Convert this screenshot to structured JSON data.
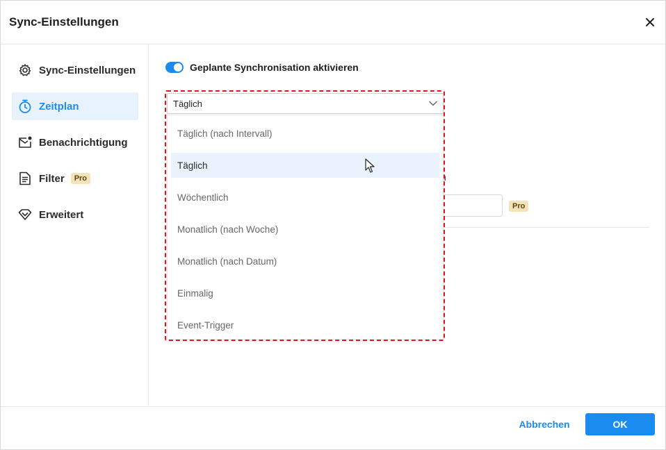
{
  "dialog": {
    "title": "Sync-Einstellungen"
  },
  "sidebar": {
    "items": [
      {
        "label": "Sync-Einstellungen",
        "icon": "gear-icon",
        "active": false
      },
      {
        "label": "Zeitplan",
        "icon": "stopwatch-icon",
        "active": true
      },
      {
        "label": "Benachrichtigung",
        "icon": "mail-notification-icon",
        "active": false
      },
      {
        "label": "Filter",
        "icon": "document-filter-icon",
        "active": false,
        "badge": "Pro"
      },
      {
        "label": "Erweitert",
        "icon": "diamond-icon",
        "active": false
      }
    ]
  },
  "schedule": {
    "toggle_label": "Geplante Synchronisation aktivieren",
    "toggle_on": true,
    "select_value": "Täglich",
    "options": [
      "Täglich (nach Intervall)",
      "Täglich",
      "Wöchentlich",
      "Monatlich (nach Woche)",
      "Monatlich (nach Datum)",
      "Einmalig",
      "Event-Trigger"
    ],
    "hovered_option": "Täglich",
    "partial_text": "n",
    "pro_badge": "Pro"
  },
  "footer": {
    "cancel_label": "Abbrechen",
    "ok_label": "OK"
  },
  "colors": {
    "accent": "#1a8cf0",
    "highlight": "#e0141e",
    "pro_badge_bg": "#f6e2b8"
  }
}
